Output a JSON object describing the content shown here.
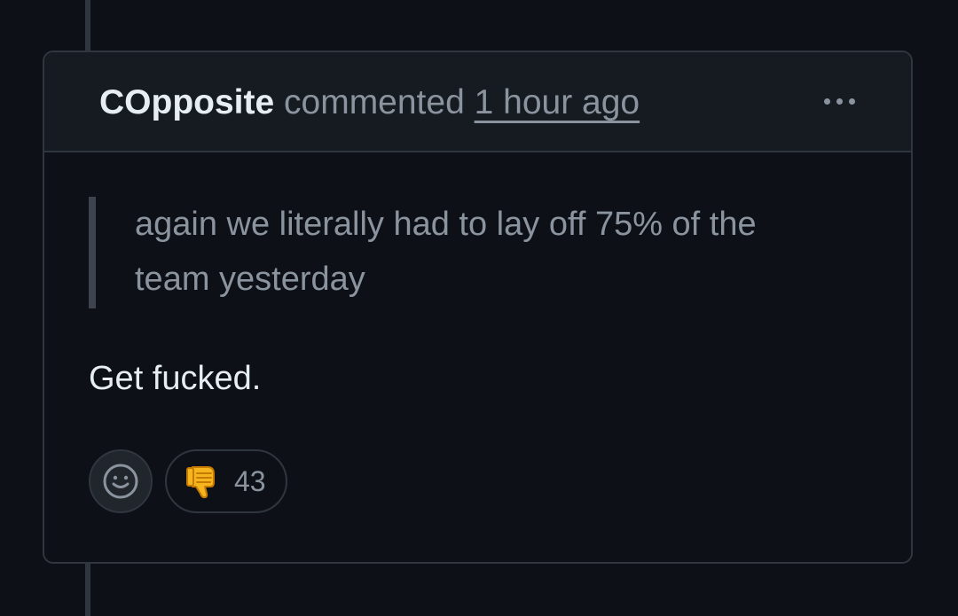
{
  "comment": {
    "author": "COpposite",
    "action": "commented",
    "timestamp": "1 hour ago",
    "quote": "again we literally had to lay off 75% of the team yesterday",
    "body": "Get fucked.",
    "reaction": {
      "emoji": "thumbs-down",
      "count": "43"
    },
    "menu_icon": "kebab-horizontal-icon",
    "add_reaction_icon": "smiley-icon"
  },
  "colors": {
    "page_background": "#0d1117",
    "header_background": "#161b22",
    "border": "#30363d",
    "muted_text": "#8b949e",
    "primary_text": "#e6edf3",
    "thumbs_down": "#f5b51f"
  }
}
